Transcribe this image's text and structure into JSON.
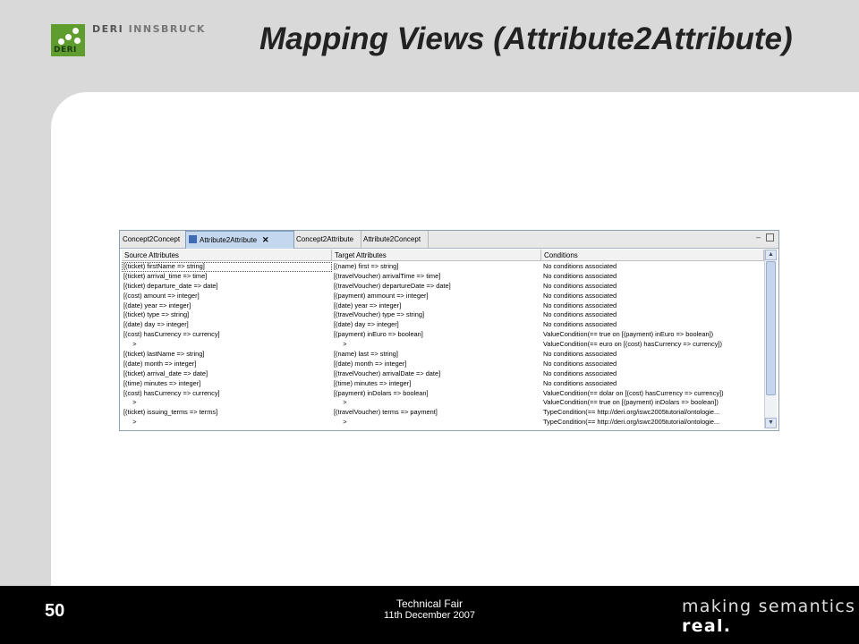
{
  "header": {
    "logo_label": "DERI",
    "org_name_a": "DERI",
    "org_name_b": "INNSBRUCK",
    "title": "Mapping Views (Attribute2Attribute)"
  },
  "view": {
    "tabs": [
      {
        "label": "Concept2Concept",
        "active": false
      },
      {
        "label": "Attribute2Attribute",
        "active": true
      },
      {
        "label": "Concept2Attribute",
        "active": false
      },
      {
        "label": "Attribute2Concept",
        "active": false
      }
    ],
    "columns": [
      "Source Attributes",
      "Target Attributes",
      "Conditions"
    ],
    "rows": [
      [
        "[(ticket) firstName => string]",
        "[(name) first => string]",
        "No conditions associated"
      ],
      [
        "[(ticket) arrival_time => time]",
        "[(travelVoucher) arrivalTime => time]",
        "No conditions associated"
      ],
      [
        "[(ticket) departure_date => date]",
        "[(travelVoucher) departureDate => date]",
        "No conditions associated"
      ],
      [
        "[(cost) amount => integer]",
        "[(payment) ammount => integer]",
        "No conditions associated"
      ],
      [
        "[(date) year => integer]",
        "[(date) year => integer]",
        "No conditions associated"
      ],
      [
        "[(ticket) type => string]",
        "[(travelVoucher) type => string]",
        "No conditions associated"
      ],
      [
        "[(date) day => integer]",
        "[(date) day => integer]",
        "No conditions associated"
      ],
      [
        "[(cost) hasCurrency => currency]",
        "[(payment) inEuro => boolean]",
        "ValueCondition(== true on [(payment) inEuro => boolean])"
      ],
      [
        "     >",
        "     >",
        "ValueCondition(== euro on [(cost) hasCurrency => currency])"
      ],
      [
        "[(ticket) lastName => string]",
        "[(name) last => string]",
        "No conditions associated"
      ],
      [
        "[(date) month => integer]",
        "[(date) month => integer]",
        "No conditions associated"
      ],
      [
        "[(ticket) arrival_date => date]",
        "[(travelVoucher) arrivalDate => date]",
        "No conditions associated"
      ],
      [
        "[(time) minutes => integer]",
        "[(time) minutes => integer]",
        "No conditions associated"
      ],
      [
        "[(cost) hasCurrency => currency]",
        "[(payment) inDolars => boolean]",
        "ValueCondition(== dolar on [(cost) hasCurrency => currency])"
      ],
      [
        "     >",
        "     >",
        "ValueCondition(== true on [(payment) inDolars => boolean])"
      ],
      [
        "[(ticket) issuing_terms => terms]",
        "[(travelVoucher) terms => payment]",
        "TypeCondition(== http://deri.org/iswc2005tutorial/ontologie..."
      ],
      [
        "     >",
        "     >",
        "TypeCondition(== http://deri.org/iswc2005tutorial/ontologie..."
      ]
    ]
  },
  "footer": {
    "page_number": "50",
    "event_name": "Technical Fair",
    "event_date": "11th December 2007",
    "tagline_a": "making semantics",
    "tagline_b": "real."
  }
}
